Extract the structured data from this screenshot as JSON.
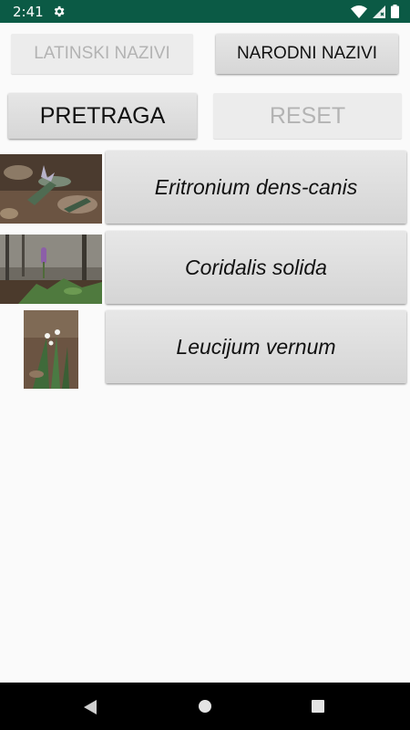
{
  "status_bar": {
    "time": "2:41",
    "icons": [
      "settings-icon",
      "wifi-icon",
      "signal-icon",
      "battery-icon"
    ]
  },
  "buttons": {
    "latinski": {
      "label": "LATINSKI NAZIVI",
      "enabled": false
    },
    "narodni": {
      "label": "NARODNI NAZIVI",
      "enabled": true
    },
    "pretraga": {
      "label": "PRETRAGA",
      "enabled": true
    },
    "reset": {
      "label": "RESET",
      "enabled": false
    }
  },
  "plants": [
    {
      "name": "Eritronium dens-canis",
      "image": "eritronium-photo"
    },
    {
      "name": "Coridalis solida",
      "image": "coridalis-photo"
    },
    {
      "name": "Leucijum vernum",
      "image": "leucijum-photo"
    }
  ],
  "navigation": [
    "back-icon",
    "home-icon",
    "recent-apps-icon"
  ],
  "colors": {
    "status_bar": "#0b5a45",
    "background": "#fafafa",
    "button_enabled": "#dcdcdc",
    "button_disabled": "#ececec",
    "nav_bar": "#000000"
  }
}
